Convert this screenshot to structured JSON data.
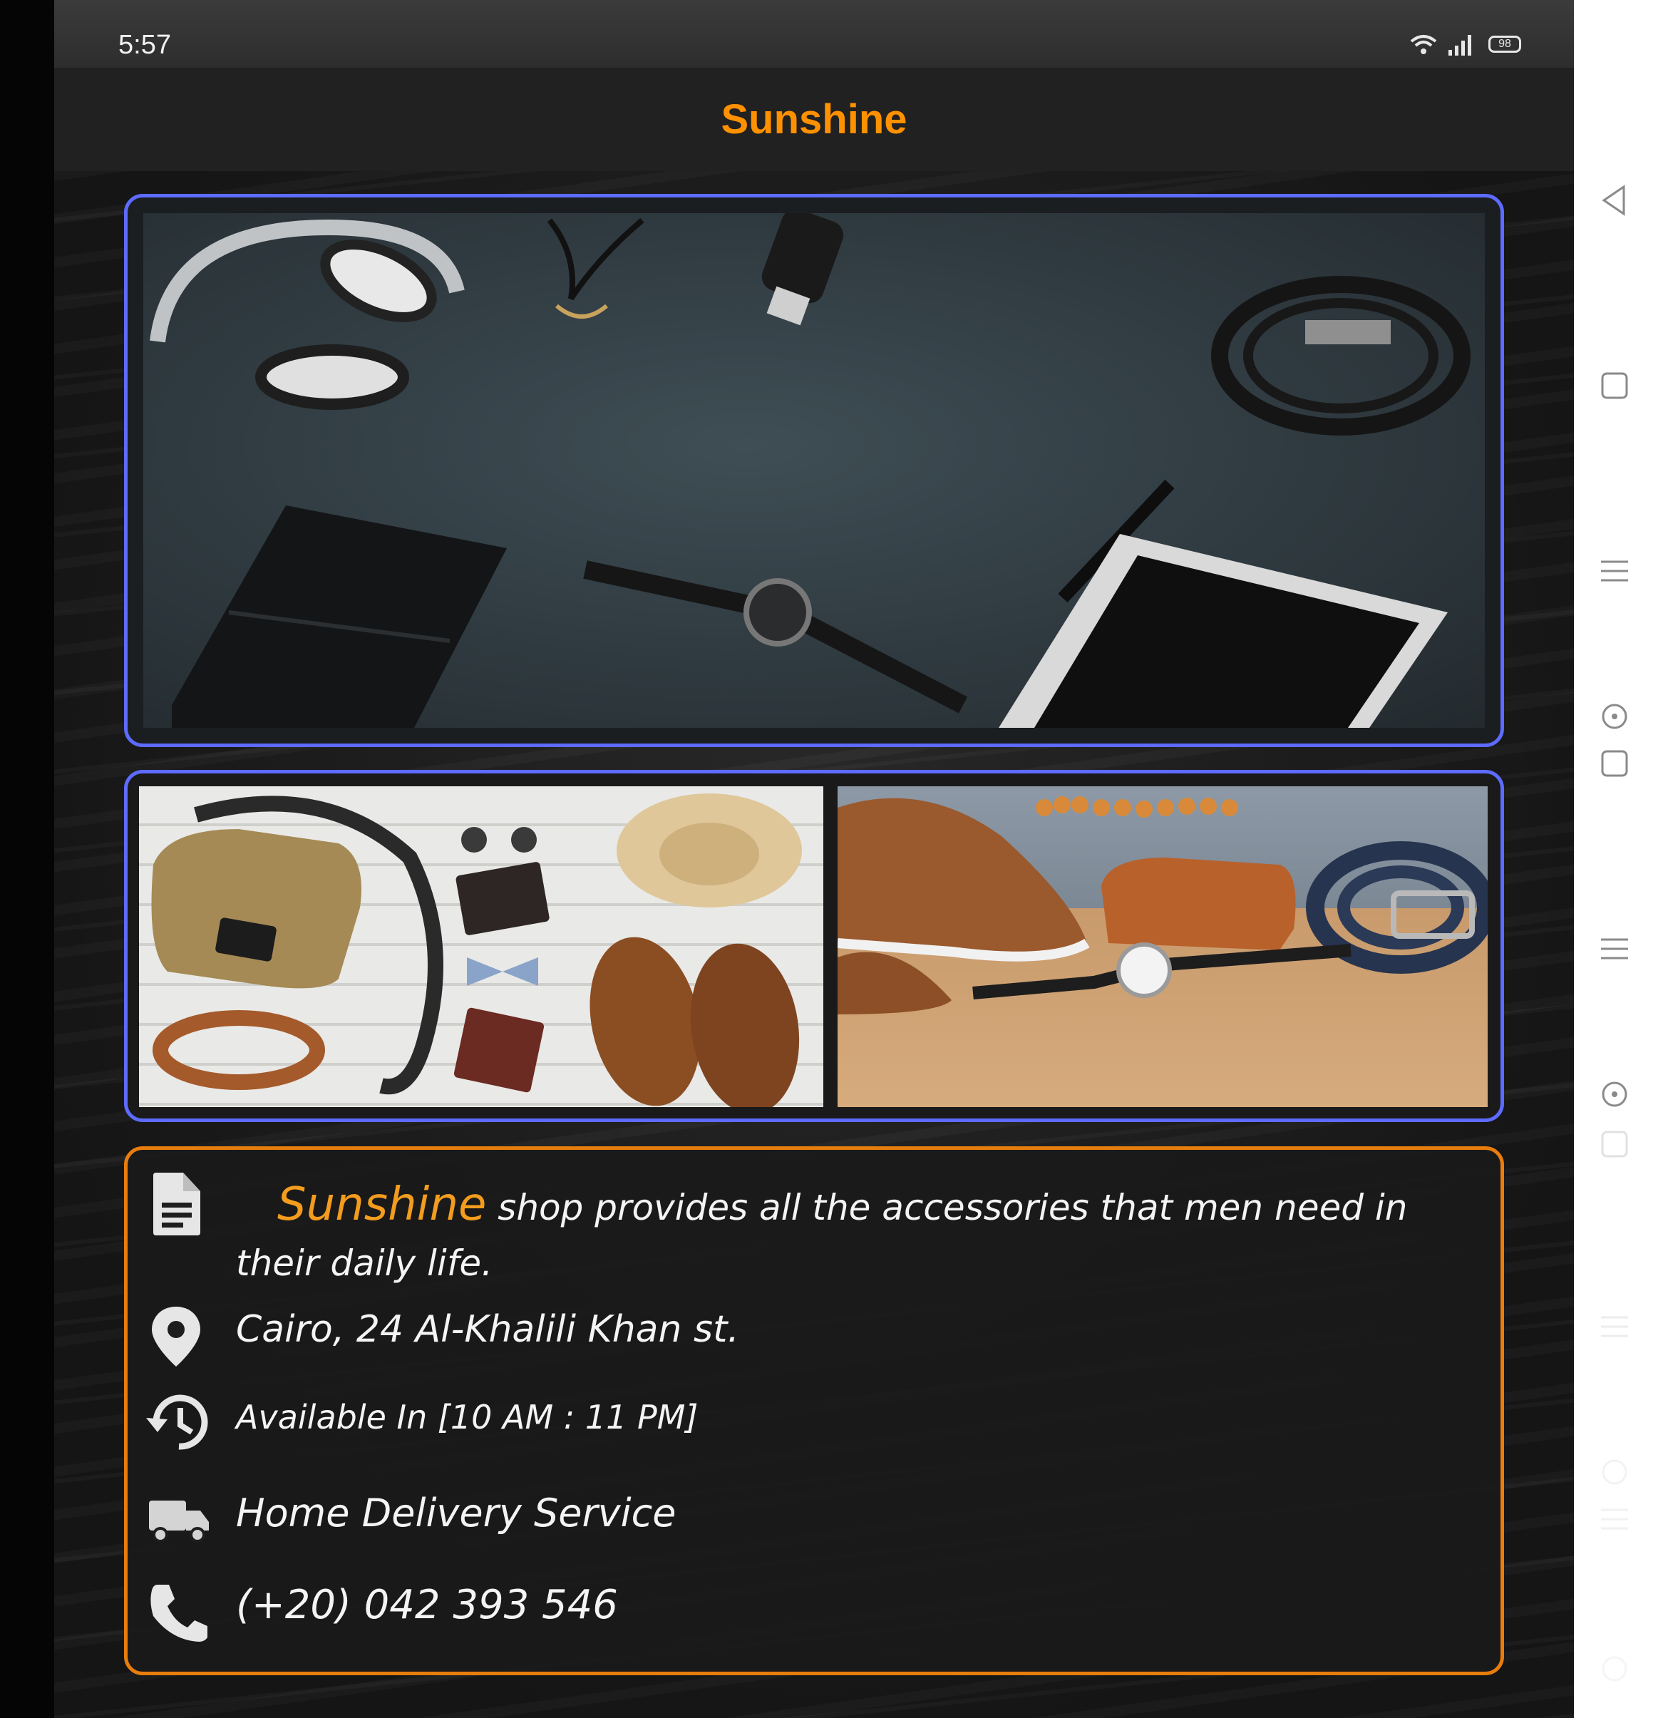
{
  "status_bar": {
    "time": "5:57",
    "battery": "98",
    "icons": [
      "wifi-icon",
      "signal-icon",
      "battery-icon"
    ]
  },
  "app_bar": {
    "title": "Sunshine",
    "title_color": "#ff9100"
  },
  "hero": {
    "image": "accessories-flatlay-photo"
  },
  "gallery": {
    "images": [
      "bag-hat-shoes-photo",
      "shoes-wallet-belt-photo"
    ]
  },
  "info": {
    "brand": "Sunshine",
    "description": " shop provides all the accessories that men need in their daily life.",
    "address": "Cairo, 24 Al-Khalili Khan st.",
    "hours": "Available In [10 AM : 11 PM]",
    "delivery": "Home Delivery Service",
    "phone": "(+20) 042 393 546",
    "icons": [
      "document-icon",
      "location-pin-icon",
      "clock-history-icon",
      "truck-icon",
      "phone-icon"
    ]
  },
  "colors": {
    "accent_orange": "#ff9100",
    "panel_border_blue": "#5d6bff",
    "panel_border_orange": "#e87d0d"
  },
  "nav_rail": {
    "icons": [
      "back-icon",
      "recents-icon",
      "menu-icon",
      "radio-icon",
      "square-icon",
      "menu-icon",
      "radio-icon"
    ]
  }
}
